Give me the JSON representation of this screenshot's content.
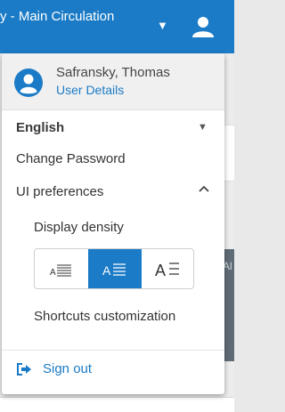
{
  "header": {
    "title": "y - Main Circulation",
    "dropdown_icon": "caret-down-icon",
    "user_icon": "user-icon"
  },
  "background": {
    "fragment_text": "Al"
  },
  "menu": {
    "user": {
      "name": "Safransky, Thomas",
      "details_link": "User Details",
      "avatar_icon": "user-circle-icon"
    },
    "language": {
      "label": "English",
      "icon": "caret-down-icon"
    },
    "change_password": "Change Password",
    "ui_preferences": {
      "label": "UI preferences",
      "icon": "chevron-up-icon",
      "density_label": "Display density",
      "density_options": [
        {
          "glyph": "A",
          "icon": "density-compact-icon"
        },
        {
          "glyph": "A",
          "icon": "density-default-icon"
        },
        {
          "glyph": "A",
          "icon": "density-comfortable-icon"
        }
      ],
      "selected_density_index": 1,
      "shortcuts": "Shortcuts customization"
    },
    "sign_out": {
      "label": "Sign out",
      "icon": "sign-out-icon"
    }
  },
  "colors": {
    "primary": "#1b7bc6",
    "header_bg": "#1b7bc6",
    "text": "#333333"
  }
}
